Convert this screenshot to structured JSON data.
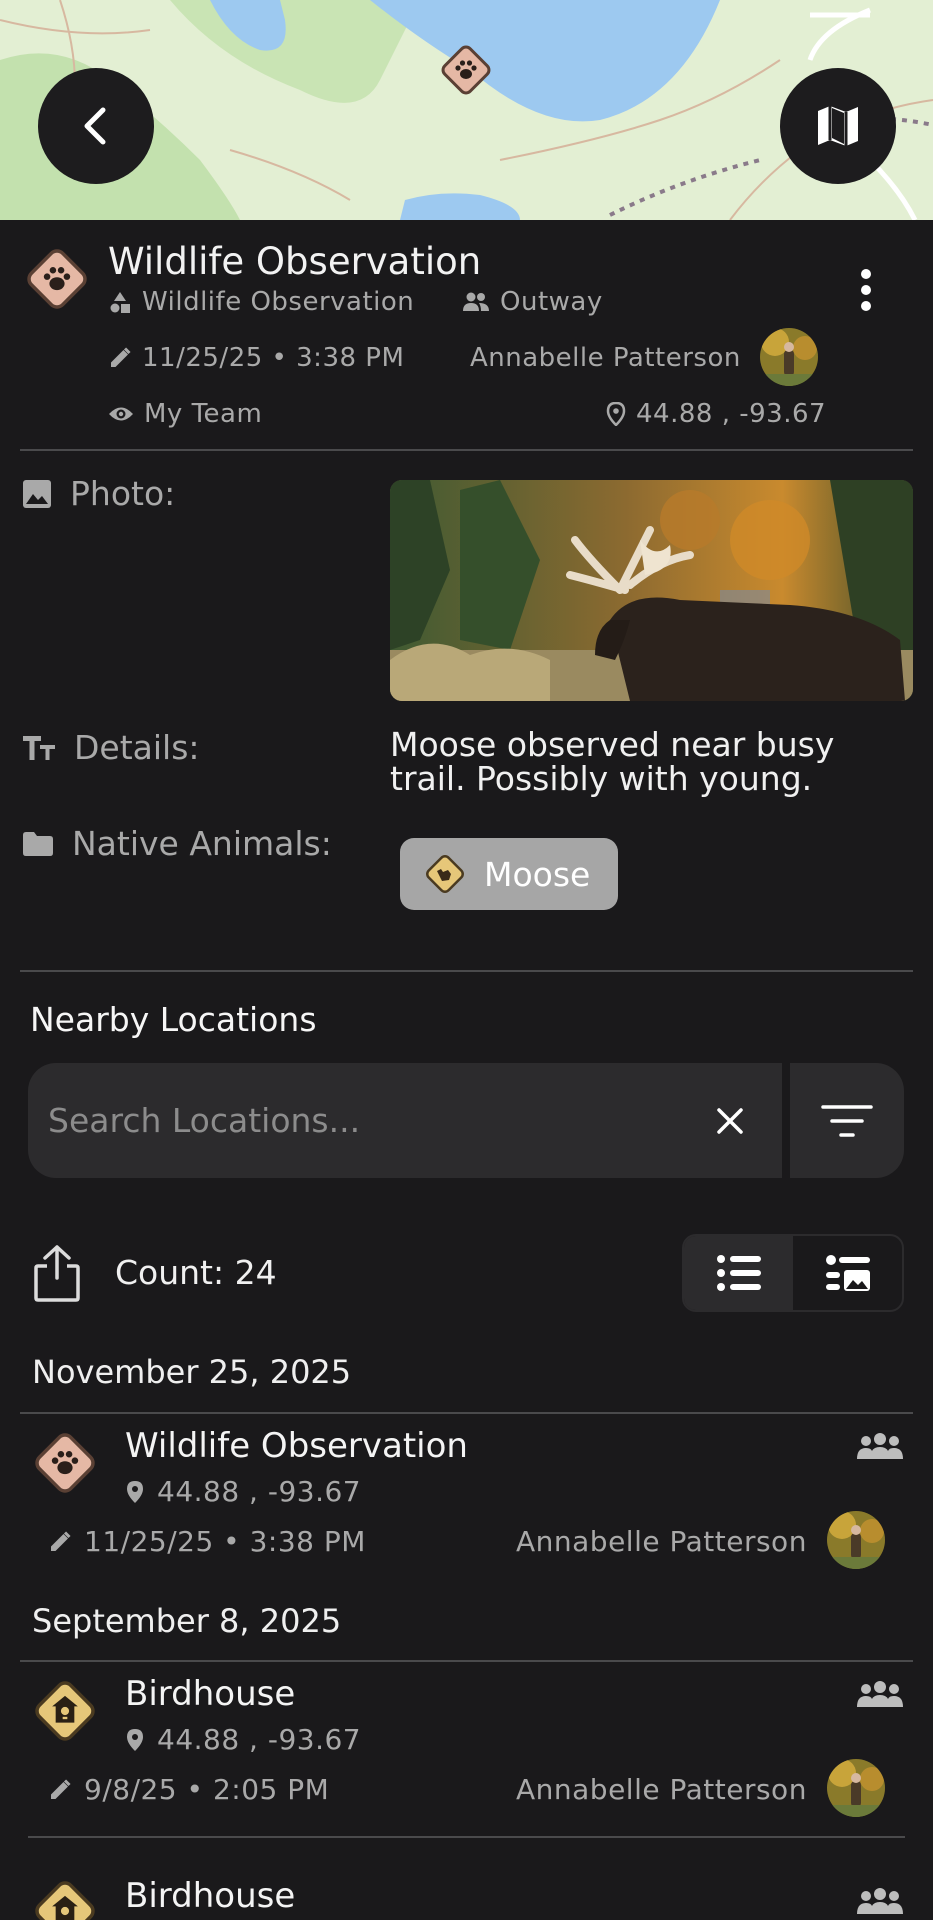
{
  "detail": {
    "title": "Wildlife Observation",
    "type": "Wildlife Observation",
    "group": "Outway",
    "edited": "11/25/25 • 3:38 PM",
    "author": "Annabelle Patterson",
    "visibility": "My Team",
    "coords": "44.88 , -93.67"
  },
  "fields": {
    "photo_label": "Photo:",
    "details_label": "Details:",
    "details_value": "Moose observed near busy trail. Possibly with young.",
    "animals_label": "Native Animals:",
    "animal_chip": "Moose"
  },
  "nearby": {
    "title": "Nearby Locations",
    "search_placeholder": "Search Locations...",
    "count": "Count: 24",
    "groups": [
      {
        "date": "November 25, 2025",
        "items": [
          {
            "title": "Wildlife Observation",
            "coords": "44.88 , -93.67",
            "edited": "11/25/25 • 3:38 PM",
            "author": "Annabelle Patterson",
            "icon": "paw-icon"
          }
        ]
      },
      {
        "date": "September 8, 2025",
        "items": [
          {
            "title": "Birdhouse",
            "coords": "44.88 , -93.67",
            "edited": "9/8/25 • 2:05 PM",
            "author": "Annabelle Patterson",
            "icon": "birdhouse-icon"
          },
          {
            "title": "Birdhouse",
            "icon": "birdhouse-icon"
          }
        ]
      }
    ]
  },
  "colors": {
    "background": "#1a191b",
    "surface": "#2c2b2d",
    "muted_text": "#a9a9a9",
    "wildlife_marker": "#e5b8a5",
    "birdhouse_marker": "#e6c779",
    "map_water": "#9dc9f0",
    "map_land": "#e3efd3"
  }
}
